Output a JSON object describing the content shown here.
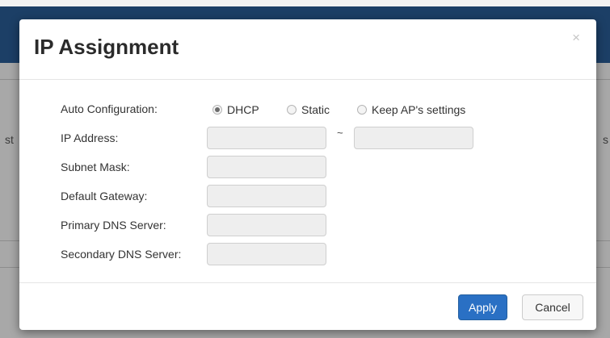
{
  "background": {
    "left_fragment": "st",
    "right_fragment": "s"
  },
  "dialog": {
    "title": "IP Assignment",
    "close_glyph": "×",
    "auto_config": {
      "label": "Auto Configuration:",
      "options": [
        "DHCP",
        "Static",
        "Keep AP's settings"
      ],
      "selected": "DHCP"
    },
    "fields": {
      "ip_address": {
        "label": "IP Address:",
        "start_value": "",
        "end_value": "",
        "range_separator": "~"
      },
      "subnet_mask": {
        "label": "Subnet Mask:",
        "value": ""
      },
      "default_gateway": {
        "label": "Default Gateway:",
        "value": ""
      },
      "primary_dns": {
        "label": "Primary DNS Server:",
        "value": ""
      },
      "secondary_dns": {
        "label": "Secondary DNS Server:",
        "value": ""
      }
    },
    "buttons": {
      "apply": "Apply",
      "cancel": "Cancel"
    },
    "colors": {
      "apply_button": "#2a70c4",
      "field_background": "#eeeeee",
      "backdrop_band": "#1c3f66"
    }
  }
}
